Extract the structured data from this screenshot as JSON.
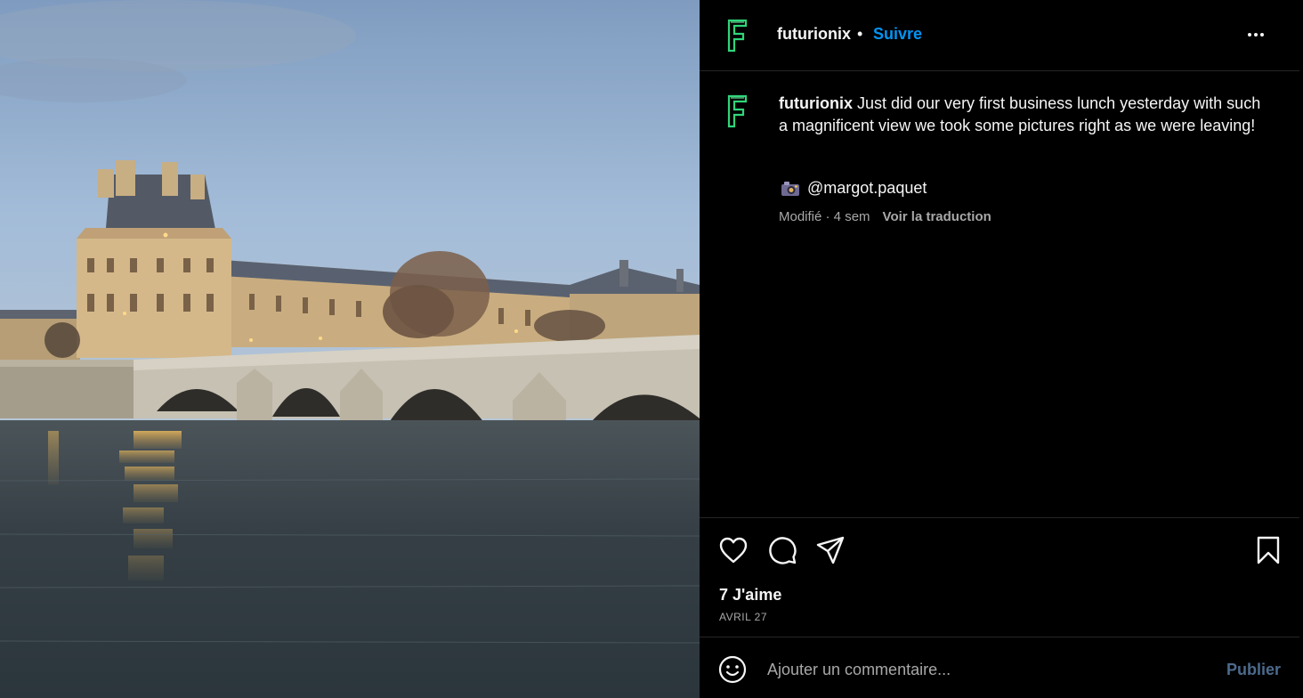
{
  "post": {
    "username": "futurionix",
    "separator": "•",
    "follow_label": "Suivre",
    "caption_username": "futurionix",
    "caption_text": " Just did our very first business lunch yesterday with such a magnificent view we took some pictures right as we were leaving!",
    "credit_handle": "@margot.paquet",
    "meta_edited": "Modifié · 4 sem",
    "translate_label": "Voir la traduction",
    "likes_text": "7 J'aime",
    "date_text": "AVRIL 27"
  },
  "comment": {
    "placeholder": "Ajouter un commentaire...",
    "publish_label": "Publier"
  },
  "icons": {
    "avatar": "letter-f-logo",
    "more": "more-horizontal-icon",
    "like": "heart-icon",
    "comment": "comment-icon",
    "share": "send-icon",
    "save": "bookmark-icon",
    "emoji": "emoji-icon",
    "camera": "camera-emoji"
  },
  "colors": {
    "background": "#000000",
    "text": "#f5f5f5",
    "secondary_text": "#a8a8a8",
    "follow_blue": "#0095f6",
    "publish_disabled": "#4c6a8c",
    "divider": "#262626"
  }
}
